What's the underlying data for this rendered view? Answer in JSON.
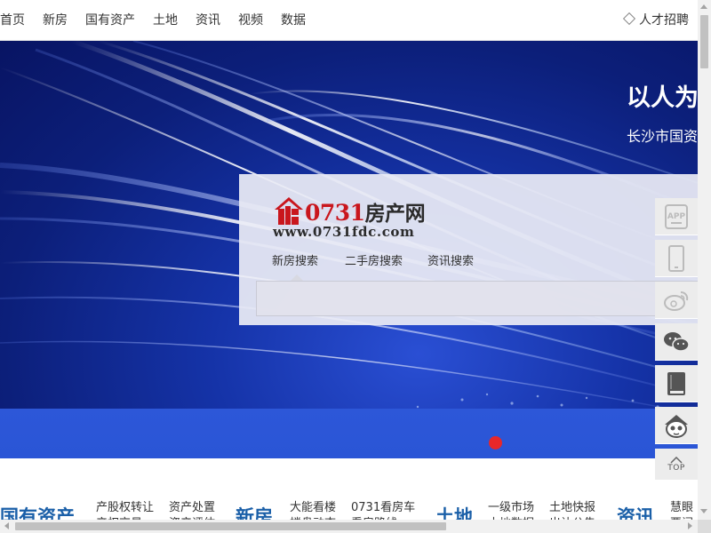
{
  "nav": {
    "items": [
      {
        "label": "首页",
        "name": "nav-home"
      },
      {
        "label": "新房",
        "name": "nav-new-homes"
      },
      {
        "label": "国有资产",
        "name": "nav-state-assets"
      },
      {
        "label": "土地",
        "name": "nav-land"
      },
      {
        "label": "资讯",
        "name": "nav-news"
      },
      {
        "label": "视频",
        "name": "nav-video"
      },
      {
        "label": "数据",
        "name": "nav-data"
      }
    ],
    "talent_label": "人才招聘",
    "talent_icon": "diamond-icon"
  },
  "banner": {
    "slogan": "以人为",
    "slogan_sub": "长沙市国资",
    "active_slide": 1
  },
  "search": {
    "logo_number": "0731",
    "logo_cn": "房产网",
    "logo_url": "www.0731fdc.com",
    "tabs": [
      "新房搜索",
      "二手房搜索",
      "资讯搜索"
    ],
    "active_tab": 0,
    "input_value": "",
    "input_placeholder": ""
  },
  "sidebar": {
    "buttons": [
      "app-icon",
      "phone-icon",
      "weibo-icon",
      "wechat-icon",
      "book-icon",
      "mascot-icon"
    ],
    "top_label": "TOP"
  },
  "sections": {
    "state_assets": {
      "title": "国有资产",
      "links": [
        "产股权转让",
        "资产处置"
      ],
      "links2": [
        "产权交易",
        "资产评估"
      ]
    },
    "new_homes": {
      "title": "新房",
      "links": [
        "大能看楼",
        "0731看房车"
      ],
      "links2": [
        "楼盘动态",
        "看房路线"
      ]
    },
    "land": {
      "title": "土地",
      "links": [
        "一级市场",
        "土地快报"
      ],
      "links2": [
        "土地数据",
        "出让公告"
      ]
    },
    "news": {
      "title": "资讯",
      "links": [
        "慧眼"
      ],
      "links2": [
        "要闻"
      ]
    }
  },
  "colors": {
    "accent_red": "#e8272a",
    "logo_red": "#c9161d",
    "section_blue": "#1a5fa8",
    "banner_blue": "#0c1f7a"
  }
}
